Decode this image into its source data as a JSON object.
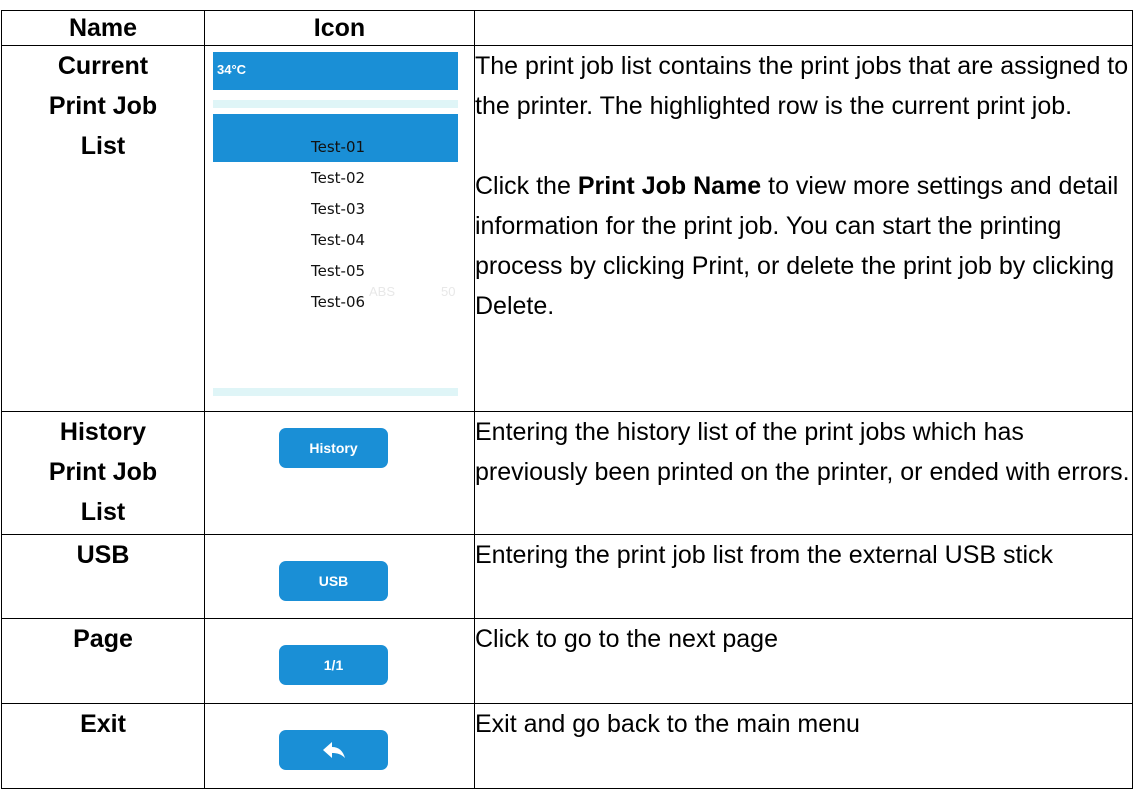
{
  "table": {
    "header": {
      "name": "Name",
      "icon": "Icon"
    },
    "rows": [
      {
        "name_lines": [
          "Current",
          "Print Job",
          "List"
        ],
        "preview": {
          "temperature": "34°C",
          "jobs": [
            "Test-01",
            "Test-02",
            "Test-03",
            "Test-04",
            "Test-05",
            "Test-06"
          ],
          "ghost_left": "ABS",
          "ghost_right": "50"
        },
        "desc_1": "The print job list contains the print jobs that are assigned to the printer. The highlighted row is the current print job.",
        "desc_2_pre": "Click the ",
        "desc_2_bold": "Print Job Name",
        "desc_2_post": " to view more settings and detail information for the print job. You can start the printing process by clicking Print, or delete the print job by clicking Delete."
      },
      {
        "name_lines": [
          "History",
          "Print Job",
          "List"
        ],
        "button_label": "History",
        "desc": "Entering the history list of the print jobs which has previously been printed on the printer, or ended with errors."
      },
      {
        "name_lines": [
          "USB"
        ],
        "button_label": "USB",
        "desc": "Entering the print job list from the external USB stick"
      },
      {
        "name_lines": [
          "Page"
        ],
        "button_label": "1/1",
        "desc": "Click to go to the next page"
      },
      {
        "name_lines": [
          "Exit"
        ],
        "button_icon": "back-arrow-icon",
        "desc": "Exit and go back to the main menu"
      }
    ]
  },
  "colors": {
    "button": "#1a8fd6",
    "highlight": "#1a8fd6",
    "strip": "#dff5f7"
  }
}
